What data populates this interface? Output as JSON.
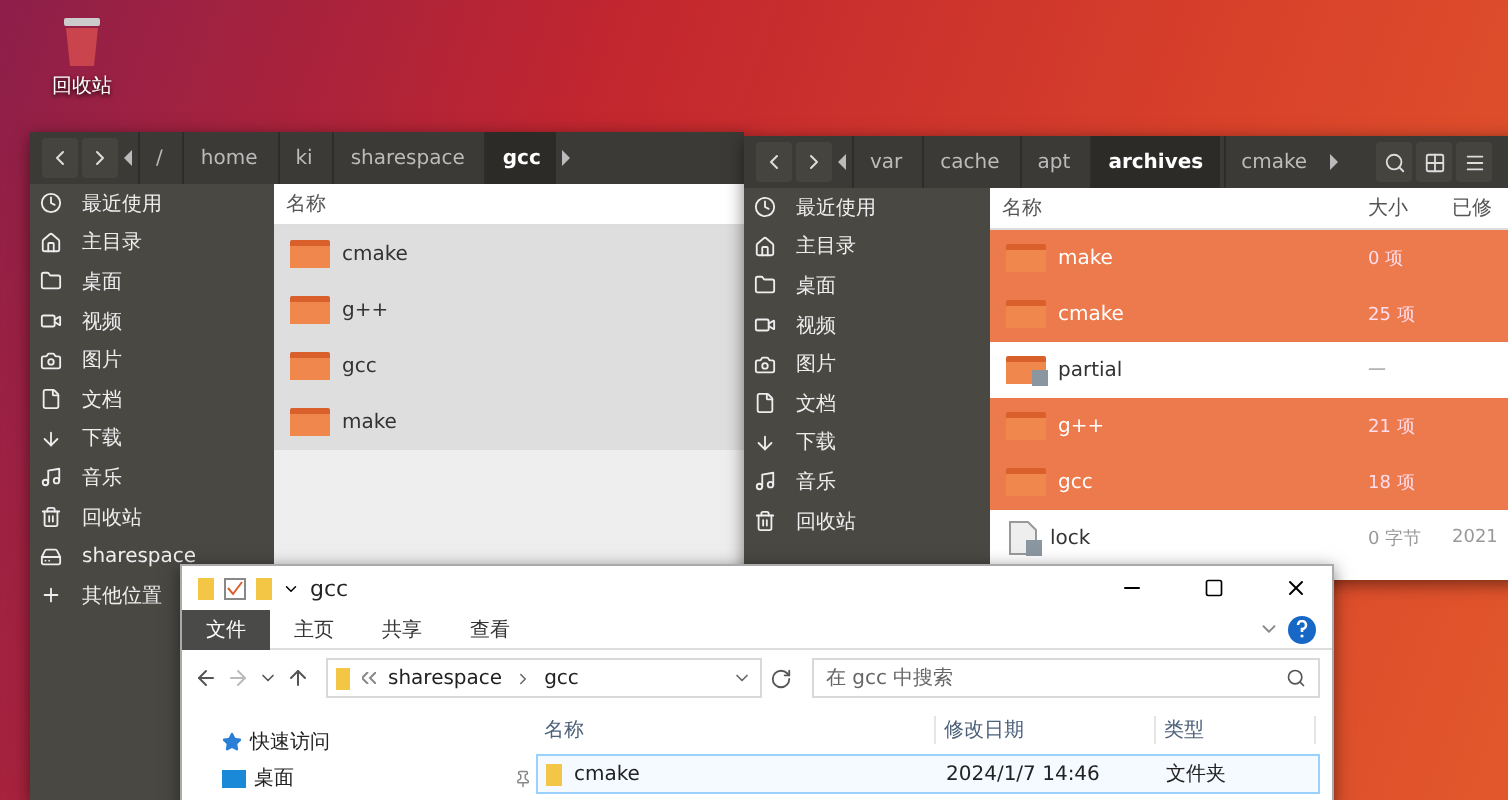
{
  "desktop": {
    "icons": [
      {
        "label": "回收站"
      }
    ]
  },
  "file_manager_left": {
    "path": [
      {
        "label": "/",
        "selected": false
      },
      {
        "label": "home",
        "selected": false
      },
      {
        "label": "ki",
        "selected": false
      },
      {
        "label": "sharespace",
        "selected": false
      },
      {
        "label": "gcc",
        "selected": true
      }
    ],
    "sidebar": [
      {
        "label": "最近使用"
      },
      {
        "label": "主目录"
      },
      {
        "label": "桌面"
      },
      {
        "label": "视频"
      },
      {
        "label": "图片"
      },
      {
        "label": "文档"
      },
      {
        "label": "下载"
      },
      {
        "label": "音乐"
      },
      {
        "label": "回收站"
      },
      {
        "label": "sharespace"
      },
      {
        "label": "其他位置"
      }
    ],
    "columns": [
      "名称"
    ],
    "files": [
      {
        "name": "cmake"
      },
      {
        "name": "g++"
      },
      {
        "name": "gcc"
      },
      {
        "name": "make"
      }
    ]
  },
  "file_manager_right": {
    "path": [
      {
        "label": "var",
        "selected": false
      },
      {
        "label": "cache",
        "selected": false
      },
      {
        "label": "apt",
        "selected": false
      },
      {
        "label": "archives",
        "selected": true
      },
      {
        "label": "cmake",
        "selected": false
      }
    ],
    "sidebar": [
      {
        "label": "最近使用"
      },
      {
        "label": "主目录"
      },
      {
        "label": "桌面"
      },
      {
        "label": "视频"
      },
      {
        "label": "图片"
      },
      {
        "label": "文档"
      },
      {
        "label": "下载"
      },
      {
        "label": "音乐"
      },
      {
        "label": "回收站"
      }
    ],
    "columns": [
      "名称",
      "大小",
      "已修"
    ],
    "files": [
      {
        "name": "make",
        "size": "0 项",
        "kind": "folder",
        "selected": true
      },
      {
        "name": "cmake",
        "size": "25 项",
        "kind": "folder",
        "selected": true
      },
      {
        "name": "partial",
        "size": "—",
        "kind": "locked-folder",
        "selected": false
      },
      {
        "name": "g++",
        "size": "21 项",
        "kind": "folder",
        "selected": true
      },
      {
        "name": "gcc",
        "size": "18 项",
        "kind": "folder",
        "selected": true
      },
      {
        "name": "lock",
        "size": "0 字节",
        "modified": "2021",
        "kind": "locked-file",
        "selected": false
      }
    ]
  },
  "explorer": {
    "title": "gcc",
    "ribbon_tabs": [
      {
        "label": "文件",
        "selected": true
      },
      {
        "label": "主页",
        "selected": false
      },
      {
        "label": "共享",
        "selected": false
      },
      {
        "label": "查看",
        "selected": false
      }
    ],
    "address": [
      "sharespace",
      "gcc"
    ],
    "search": {
      "placeholder": "在 gcc 中搜索"
    },
    "nav": [
      {
        "label": "快速访问",
        "kind": "star"
      },
      {
        "label": "桌面",
        "kind": "desktop"
      }
    ],
    "columns": [
      "名称",
      "修改日期",
      "类型"
    ],
    "rows": [
      {
        "name": "cmake",
        "modified": "2024/1/7 14:46",
        "type": "文件夹",
        "selected": true
      }
    ]
  }
}
